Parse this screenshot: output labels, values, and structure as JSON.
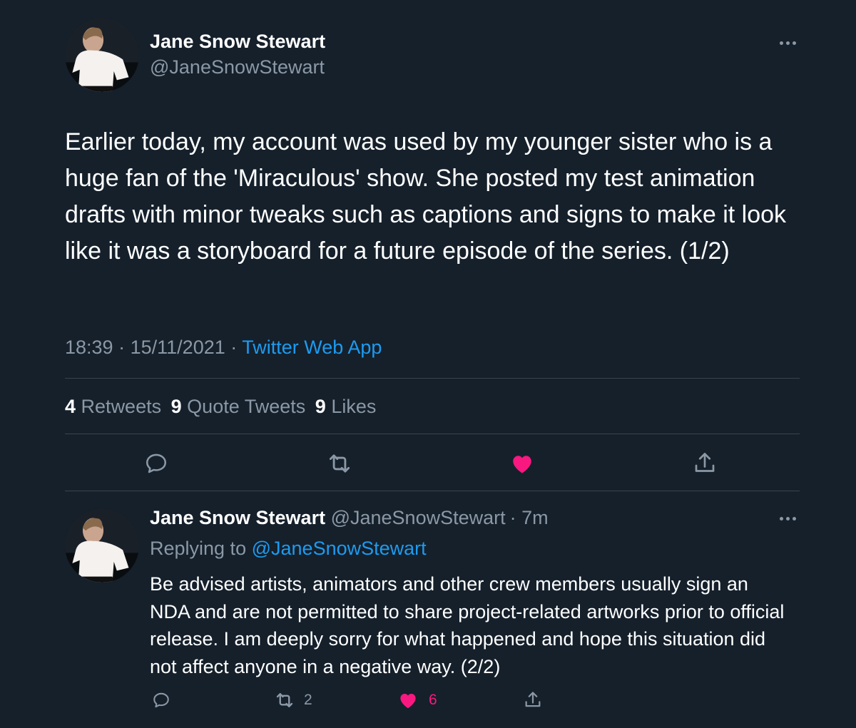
{
  "main_tweet": {
    "author_name": "Jane Snow Stewart",
    "author_handle": "@JaneSnowStewart",
    "text": "Earlier today, my account was used by my younger sister who is a huge fan of the 'Miraculous' show. She posted my test animation drafts with minor tweaks such as captions and signs to make it look like it was a storyboard for a future episode of the series. (1/2)",
    "time": "18:39",
    "separator": "·",
    "date": "15/11/2021",
    "source": "Twitter Web App",
    "stats": {
      "retweets_count": "4",
      "retweets_label": "Retweets",
      "quotes_count": "9",
      "quotes_label": "Quote Tweets",
      "likes_count": "9",
      "likes_label": "Likes"
    },
    "liked": true
  },
  "reply_tweet": {
    "author_name": "Jane Snow Stewart",
    "author_handle": "@JaneSnowStewart",
    "time_ago": "· 7m",
    "replying_label": "Replying to",
    "replying_to": "@JaneSnowStewart",
    "text": "Be advised artists, animators and other crew members usually sign an NDA and are not permitted to share project-related artworks prior to official release. I am deeply sorry for what happened and hope this situation did not affect anyone in a negative way. (2/2)",
    "retweet_count": "2",
    "like_count": "6",
    "liked": true
  },
  "icons": {
    "more": "more-icon",
    "reply": "reply-icon",
    "retweet": "retweet-icon",
    "like": "heart-icon",
    "share": "share-icon"
  },
  "colors": {
    "background": "#15202b",
    "text": "#ffffff",
    "muted": "#8b98a5",
    "link": "#1d9bf0",
    "like": "#f91880",
    "divider": "#38444d"
  }
}
